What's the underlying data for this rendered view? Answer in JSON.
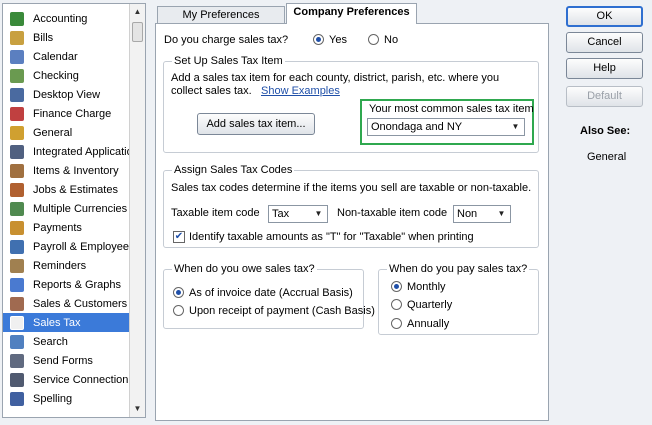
{
  "sidebar": {
    "items": [
      {
        "label": "Accounting",
        "icon": "accounting-icon",
        "color": "#3a8a3a"
      },
      {
        "label": "Bills",
        "icon": "bills-icon",
        "color": "#c8a040"
      },
      {
        "label": "Calendar",
        "icon": "calendar-icon",
        "color": "#5b7fc0"
      },
      {
        "label": "Checking",
        "icon": "checking-icon",
        "color": "#6a9a50"
      },
      {
        "label": "Desktop View",
        "icon": "desktop-view-icon",
        "color": "#4a6aa0"
      },
      {
        "label": "Finance Charge",
        "icon": "finance-charge-icon",
        "color": "#c04040"
      },
      {
        "label": "General",
        "icon": "general-icon",
        "color": "#d0a030"
      },
      {
        "label": "Integrated Applicatio",
        "icon": "integrated-applications-icon",
        "color": "#506080"
      },
      {
        "label": "Items & Inventory",
        "icon": "items-inventory-icon",
        "color": "#a07040"
      },
      {
        "label": "Jobs & Estimates",
        "icon": "jobs-estimates-icon",
        "color": "#b06030"
      },
      {
        "label": "Multiple Currencies",
        "icon": "multiple-currencies-icon",
        "color": "#508a50"
      },
      {
        "label": "Payments",
        "icon": "payments-icon",
        "color": "#c89030"
      },
      {
        "label": "Payroll & Employees",
        "icon": "payroll-employees-icon",
        "color": "#4070b0"
      },
      {
        "label": "Reminders",
        "icon": "reminders-icon",
        "color": "#a08050"
      },
      {
        "label": "Reports & Graphs",
        "icon": "reports-graphs-icon",
        "color": "#4a7ad0"
      },
      {
        "label": "Sales & Customers",
        "icon": "sales-customers-icon",
        "color": "#a06a50"
      },
      {
        "label": "Sales Tax",
        "icon": "sales-tax-icon",
        "color": "#f0f0f0",
        "selected": true
      },
      {
        "label": "Search",
        "icon": "search-icon",
        "color": "#5080c0"
      },
      {
        "label": "Send Forms",
        "icon": "send-forms-icon",
        "color": "#606a80"
      },
      {
        "label": "Service Connection",
        "icon": "service-connection-icon",
        "color": "#505a70"
      },
      {
        "label": "Spelling",
        "icon": "spelling-icon",
        "color": "#4060a0"
      }
    ]
  },
  "tabs": {
    "my_preferences": "My Preferences",
    "company_preferences": "Company Preferences"
  },
  "panel": {
    "charge_question": "Do you charge sales tax?",
    "yes_label": "Yes",
    "no_label": "No",
    "setup_group_title": "Set Up Sales Tax Item",
    "setup_text_line1": "Add a sales tax item for each county, district, parish, etc. where you",
    "setup_text_line2": "collect sales tax.",
    "show_examples": "Show Examples",
    "add_item_button": "Add sales tax item...",
    "common_item_label": "Your most common sales tax item",
    "common_item_value": "Onondaga and NY",
    "codes_group_title": "Assign Sales Tax Codes",
    "codes_text": "Sales tax codes determine if the items you sell are taxable or non-taxable.",
    "taxable_code_label": "Taxable item code",
    "taxable_code_value": "Tax",
    "nontaxable_code_label": "Non-taxable item code",
    "nontaxable_code_value": "Non",
    "identify_label": "Identify taxable amounts as \"T\" for \"Taxable\" when printing",
    "owe_group_title": "When do you owe sales tax?",
    "owe_accrual": "As of invoice date (Accrual Basis)",
    "owe_cash": "Upon receipt of payment (Cash Basis)",
    "pay_group_title": "When do you pay sales tax?",
    "pay_monthly": "Monthly",
    "pay_quarterly": "Quarterly",
    "pay_annually": "Annually"
  },
  "actions": {
    "ok": "OK",
    "cancel": "Cancel",
    "help": "Help",
    "default": "Default",
    "also_see_label": "Also See:",
    "also_see_general": "General"
  },
  "colors": {
    "highlight_border": "#2fa84f",
    "selection": "#3b7ad9"
  }
}
